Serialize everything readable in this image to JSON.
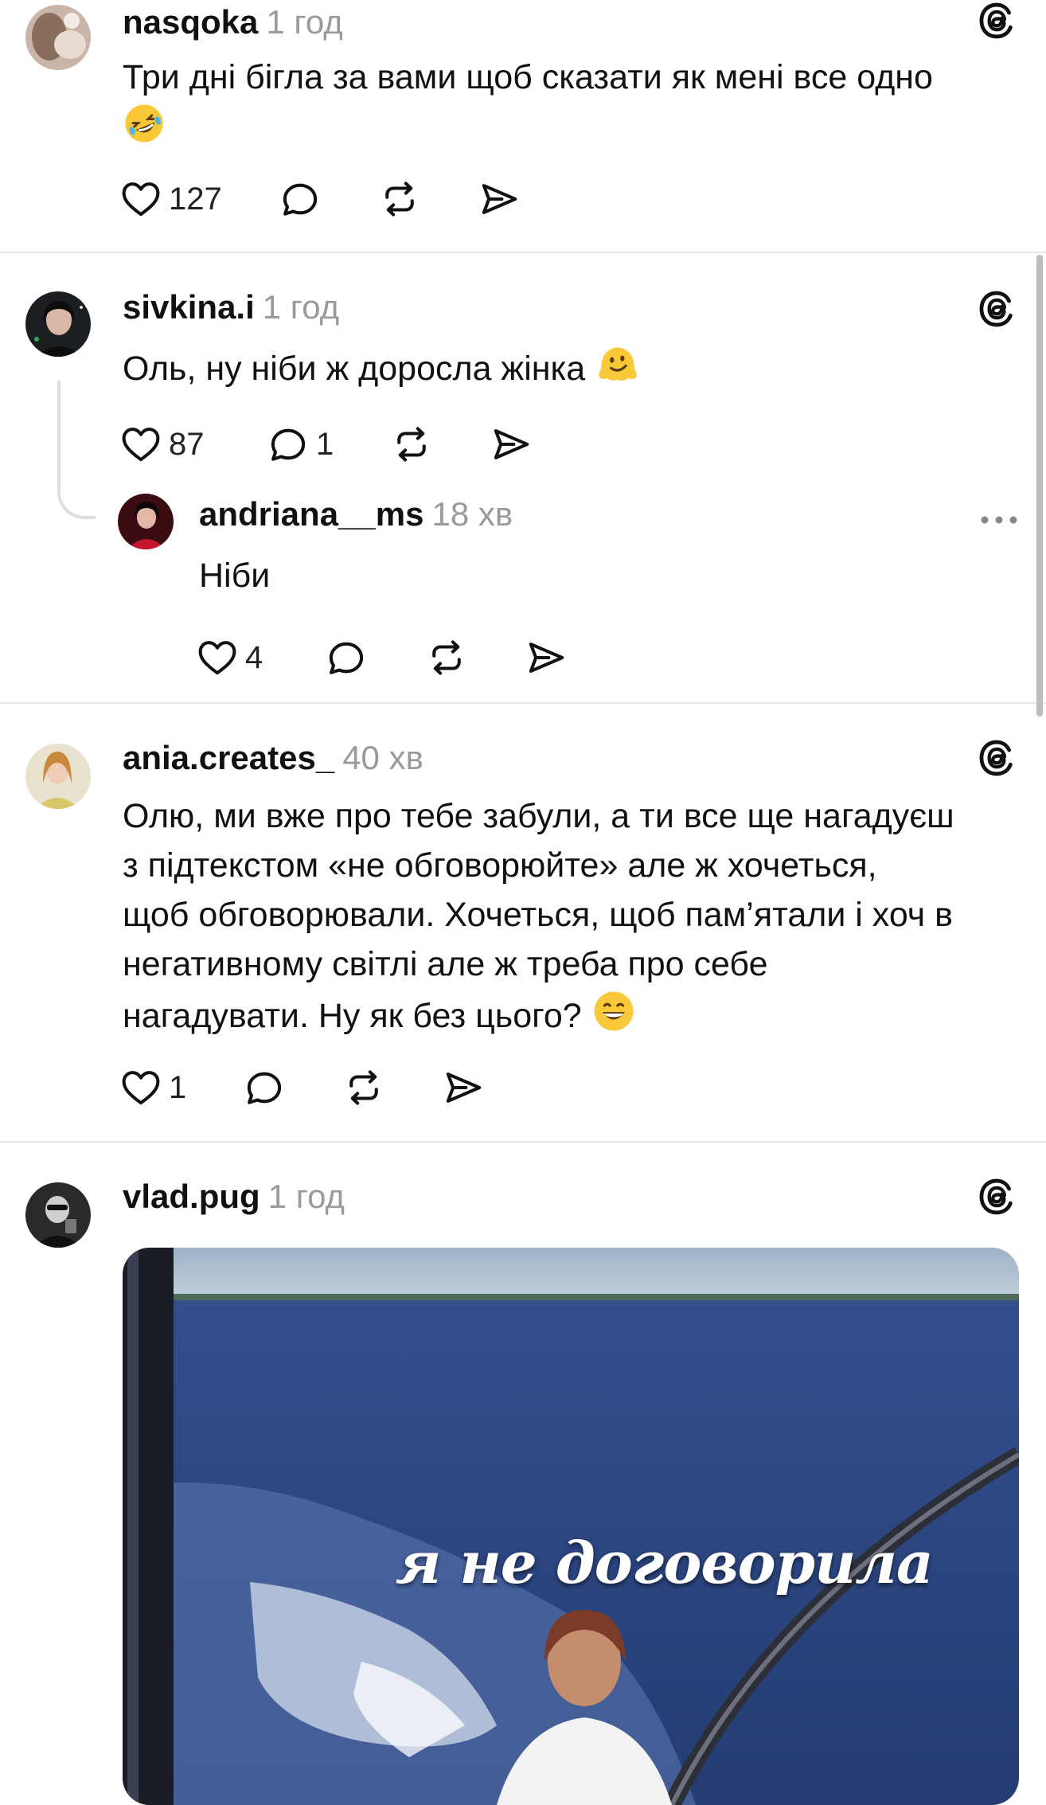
{
  "posts": [
    {
      "username": "nasqoka",
      "time": "1 год",
      "text": "Три дні бігла за вами щоб сказати як мені все одно",
      "emoji": "rolling-on-floor-laughing",
      "likes": "127"
    },
    {
      "username": "sivkina.i",
      "time": "1 год",
      "text": "Оль, ну ніби ж доросла жінка",
      "emoji": "melting-face",
      "likes": "87",
      "replies": "1"
    },
    {
      "username": "andriana__ms",
      "time": "18 хв",
      "text": "Ніби",
      "likes": "4"
    },
    {
      "username": "ania.creates_",
      "time": "40 хв",
      "text_lines": [
        "Олю, ми вже про тебе забули, а ти все ще нагадуєш",
        "з підтекстом «не обговорюйте» але ж хочеться,",
        "щоб обговорювали. Хочеться, щоб пам’ятали і хоч в",
        "негативному світлі але ж треба про себе",
        "нагадувати. Ну як без цього?"
      ],
      "emoji": "grinning-face",
      "likes": "1"
    },
    {
      "username": "vlad.pug",
      "time": "1 год",
      "image_caption": "я не договорила"
    }
  ],
  "icons": {
    "like": "heart-icon",
    "reply": "comment-icon",
    "repost": "repost-icon",
    "share": "send-icon",
    "source": "threads-logo-icon",
    "more": "more-options-icon"
  },
  "colors": {
    "text": "#111111",
    "muted": "#9a9a9a",
    "divider": "#e6e6e6",
    "sea": "#2d4a86"
  }
}
